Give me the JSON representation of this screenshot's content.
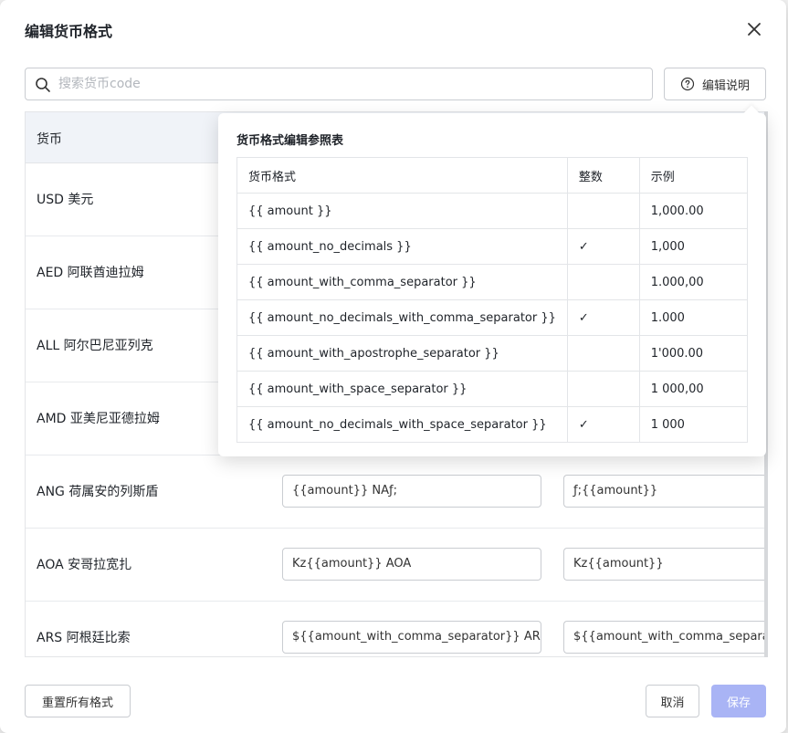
{
  "dialog": {
    "title": "编辑货币格式"
  },
  "search": {
    "placeholder": "搜索货币code",
    "value": ""
  },
  "help_button": {
    "label": "编辑说明"
  },
  "table": {
    "header": {
      "currency": "货币"
    },
    "rows": [
      {
        "name": "USD 美元",
        "format1": "",
        "format2": ""
      },
      {
        "name": "AED 阿联酋迪拉姆",
        "format1": "",
        "format2": ""
      },
      {
        "name": "ALL 阿尔巴尼亚列克",
        "format1": "",
        "format2": ""
      },
      {
        "name": "AMD 亚美尼亚德拉姆",
        "format1": "",
        "format2": ""
      },
      {
        "name": "ANG 荷属安的列斯盾",
        "format1": "{{amount}} NAƒ;",
        "format2": "ƒ;{{amount}}"
      },
      {
        "name": "AOA 安哥拉宽扎",
        "format1": "Kz{{amount}} AOA",
        "format2": "Kz{{amount}}"
      },
      {
        "name": "ARS 阿根廷比索",
        "format1": "${{amount_with_comma_separator}} ARS",
        "format2": "${{amount_with_comma_separator}}"
      }
    ]
  },
  "reference": {
    "title": "货币格式编辑参照表",
    "headers": {
      "format": "货币格式",
      "integer": "整数",
      "example": "示例"
    },
    "rows": [
      {
        "format": "{{ amount }}",
        "integer": "",
        "example": "1,000.00"
      },
      {
        "format": "{{ amount_no_decimals }}",
        "integer": "✓",
        "example": "1,000"
      },
      {
        "format": "{{ amount_with_comma_separator }}",
        "integer": "",
        "example": "1.000,00"
      },
      {
        "format": "{{ amount_no_decimals_with_comma_separator }}",
        "integer": "✓",
        "example": "1.000"
      },
      {
        "format": "{{ amount_with_apostrophe_separator }}",
        "integer": "",
        "example": "1'000.00"
      },
      {
        "format": "{{ amount_with_space_separator }}",
        "integer": "",
        "example": "1 000,00"
      },
      {
        "format": "{{ amount_no_decimals_with_space_separator }}",
        "integer": "✓",
        "example": "1 000"
      }
    ]
  },
  "footer": {
    "reset_label": "重置所有格式",
    "cancel_label": "取消",
    "save_label": "保存"
  },
  "colors": {
    "primary_disabled": "#a9b4f5",
    "header_bg": "#f0f3f8",
    "border": "#c9ccd1"
  },
  "icons": {
    "close": "close-icon",
    "search": "search-icon",
    "help": "question-circle-icon"
  }
}
